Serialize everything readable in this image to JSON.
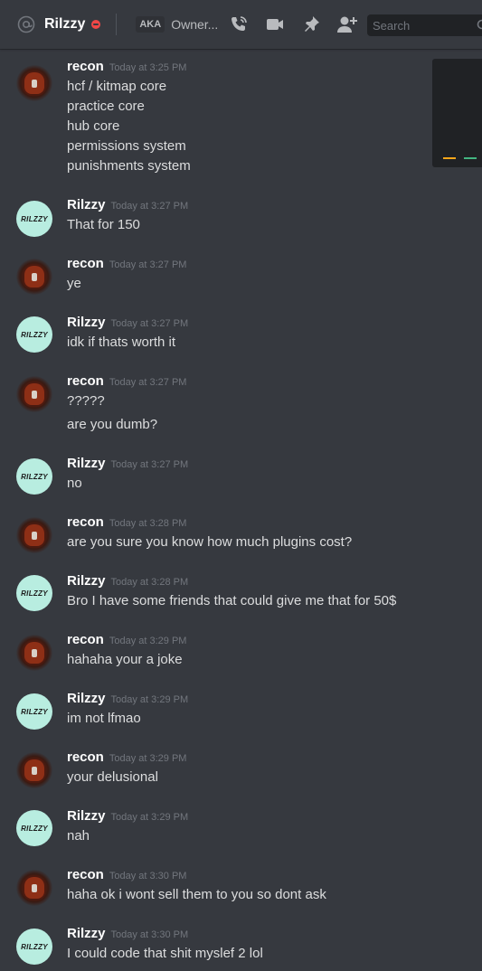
{
  "topbar": {
    "dm_name": "Rilzzy",
    "aka_label": "AKA",
    "aka_value": "Owner...",
    "search_placeholder": "Search",
    "dnd_color": "#f04747"
  },
  "colors": {
    "background": "#36393f",
    "rilzzy_avatar": "#b8ede0",
    "timestamp": "#72767d"
  },
  "messages": [
    {
      "author": "recon",
      "avatar": "recon",
      "time": "Today at 3:25 PM",
      "lines": [
        "hcf / kitmap core",
        "practice core",
        "hub core",
        "permissions system",
        "punishments system"
      ]
    },
    {
      "author": "Rilzzy",
      "avatar": "rilzzy",
      "avatar_text": "RILZZY",
      "time": "Today at 3:27 PM",
      "lines": [
        "That for 150"
      ]
    },
    {
      "author": "recon",
      "avatar": "recon",
      "time": "Today at 3:27 PM",
      "lines": [
        "ye"
      ]
    },
    {
      "author": "Rilzzy",
      "avatar": "rilzzy",
      "avatar_text": "RILZZY",
      "time": "Today at 3:27 PM",
      "lines": [
        "idk if thats worth it"
      ]
    },
    {
      "author": "recon",
      "avatar": "recon",
      "time": "Today at 3:27 PM",
      "lines": [
        "?????",
        "are you dumb?"
      ]
    },
    {
      "author": "Rilzzy",
      "avatar": "rilzzy",
      "avatar_text": "RILZZY",
      "time": "Today at 3:27 PM",
      "lines": [
        "no"
      ]
    },
    {
      "author": "recon",
      "avatar": "recon",
      "time": "Today at 3:28 PM",
      "lines": [
        "are you sure you know how much plugins cost?"
      ]
    },
    {
      "author": "Rilzzy",
      "avatar": "rilzzy",
      "avatar_text": "RILZZY",
      "time": "Today at 3:28 PM",
      "lines": [
        "Bro I have some friends that could give me that for 50$"
      ]
    },
    {
      "author": "recon",
      "avatar": "recon",
      "time": "Today at 3:29 PM",
      "lines": [
        "hahaha your a joke"
      ]
    },
    {
      "author": "Rilzzy",
      "avatar": "rilzzy",
      "avatar_text": "RILZZY",
      "time": "Today at 3:29 PM",
      "lines": [
        "im not lfmao"
      ]
    },
    {
      "author": "recon",
      "avatar": "recon",
      "time": "Today at 3:29 PM",
      "lines": [
        "your delusional"
      ]
    },
    {
      "author": "Rilzzy",
      "avatar": "rilzzy",
      "avatar_text": "RILZZY",
      "time": "Today at 3:29 PM",
      "lines": [
        "nah"
      ]
    },
    {
      "author": "recon",
      "avatar": "recon",
      "time": "Today at 3:30 PM",
      "lines": [
        "haha ok i wont sell them to you so dont ask"
      ]
    },
    {
      "author": "Rilzzy",
      "avatar": "rilzzy",
      "avatar_text": "RILZZY",
      "time": "Today at 3:30 PM",
      "lines": [
        "I could code that shit myslef 2 lol"
      ]
    }
  ]
}
